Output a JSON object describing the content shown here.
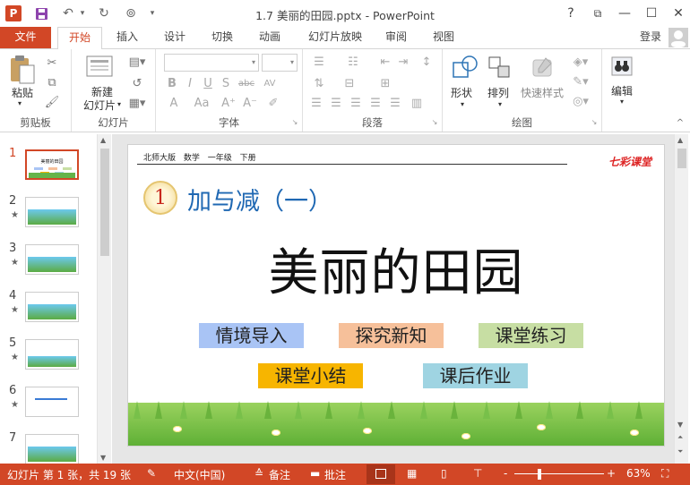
{
  "app": {
    "file_name": "1.7  美丽的田园.pptx",
    "app_name": "PowerPoint",
    "window_title": "1.7  美丽的田园.pptx - PowerPoint",
    "accent_color": "#d24726"
  },
  "window_controls": {
    "help": "?",
    "restore_ribbon": "⧉",
    "minimize": "—",
    "maximize": "☐",
    "close": "✕"
  },
  "quick_access": [
    "save-icon",
    "undo-icon",
    "redo-icon",
    "start-from-beginning-icon",
    "customize-icon"
  ],
  "tabs": [
    {
      "label": "文件"
    },
    {
      "label": "开始",
      "selected": true
    },
    {
      "label": "插入"
    },
    {
      "label": "设计"
    },
    {
      "label": "切换"
    },
    {
      "label": "动画"
    },
    {
      "label": "幻灯片放映"
    },
    {
      "label": "审阅"
    },
    {
      "label": "视图"
    }
  ],
  "signin": "登录",
  "ribbon": {
    "clipboard": {
      "paste": "粘贴",
      "group": "剪贴板"
    },
    "slides": {
      "new_slide_line1": "新建",
      "new_slide_line2": "幻灯片",
      "group": "幻灯片"
    },
    "font": {
      "group": "字体",
      "aa": "Aa"
    },
    "paragraph": {
      "group": "段落"
    },
    "drawing": {
      "shape": "形状",
      "arrange": "排列",
      "quick_styles": "快速样式",
      "group": "绘图"
    },
    "editing": {
      "edit": "编辑"
    }
  },
  "thumbnails": [
    {
      "num": "1",
      "starred": false,
      "selected": true
    },
    {
      "num": "2",
      "starred": true
    },
    {
      "num": "3",
      "starred": true
    },
    {
      "num": "4",
      "starred": true
    },
    {
      "num": "5",
      "starred": true
    },
    {
      "num": "6",
      "starred": true
    },
    {
      "num": "7",
      "starred": false
    }
  ],
  "thumb1_title": "美丽的田园",
  "slide": {
    "header": "北师大版 数学 一年级 下册",
    "brand": "七彩课堂",
    "lesson_number": "1",
    "lesson_title": "加与减（一）",
    "main_title": "美丽的田园",
    "buttons": [
      {
        "label": "情境导入",
        "color": "#a9c4f5"
      },
      {
        "label": "探究新知",
        "color": "#f6c09a"
      },
      {
        "label": "课堂练习",
        "color": "#c7dea3"
      },
      {
        "label": "课堂小结",
        "color": "#f7b500"
      },
      {
        "label": "课后作业",
        "color": "#9fd4e2"
      }
    ]
  },
  "status": {
    "slide_info": "幻灯片 第 1 张，共 19 张",
    "language": "中文(中国)",
    "notes": "备注",
    "comments": "批注",
    "zoom": "63%",
    "zoom_minus": "-",
    "zoom_plus": "+"
  }
}
